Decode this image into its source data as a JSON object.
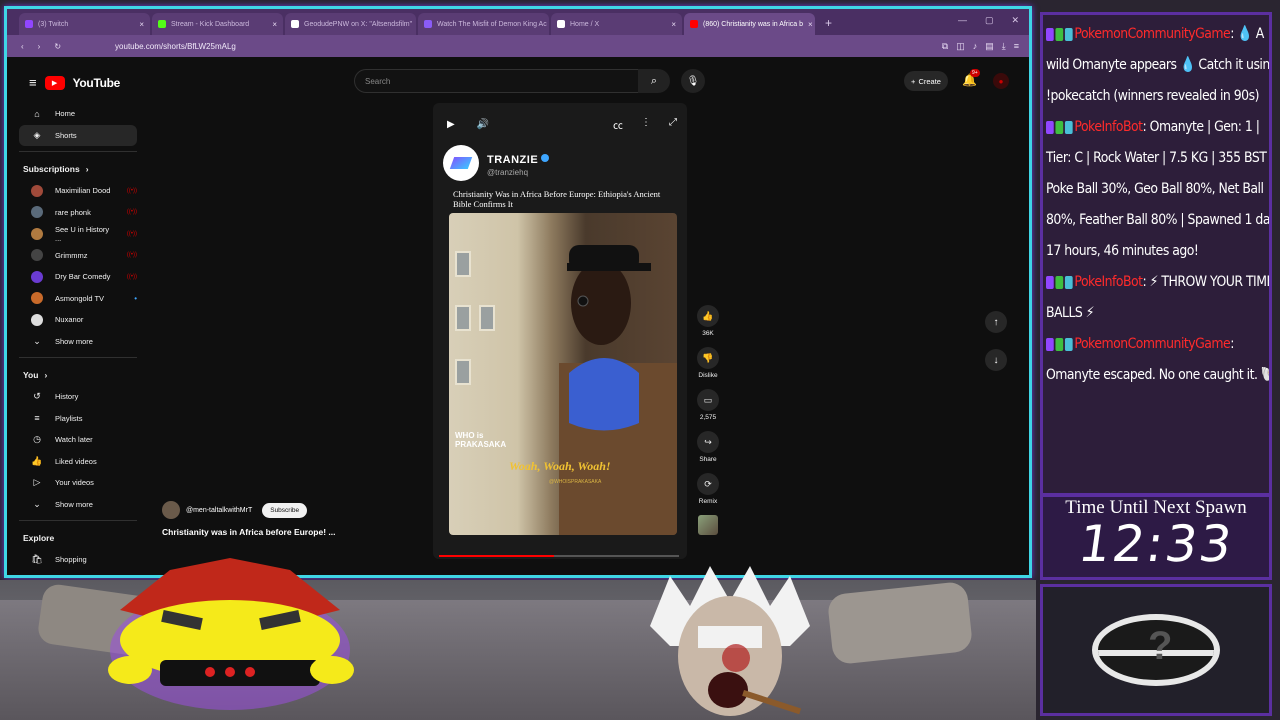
{
  "browser": {
    "tabs": [
      {
        "label": "(3) Twitch",
        "fav": "#9146ff"
      },
      {
        "label": "Stream - Kick Dashboard",
        "fav": "#53fc18"
      },
      {
        "label": "GeodudePNW on X: \"Altsendsfilm\"",
        "fav": "#ffffff"
      },
      {
        "label": "Watch The Misfit of Demon King Ac",
        "fav": "#8a5cf6"
      },
      {
        "label": "Home / X",
        "fav": "#ffffff"
      },
      {
        "label": "(860) Christianity was in Africa b",
        "fav": "#ff0000"
      }
    ],
    "url": "youtube.com/shorts/BfLW25mALg"
  },
  "youtube": {
    "logo_text": "YouTube",
    "search_placeholder": "Search",
    "create_label": "Create",
    "notif_count": "9+",
    "sidebar": {
      "main": [
        {
          "label": "Home",
          "icon": "home-icon",
          "glyph": "⌂"
        },
        {
          "label": "Shorts",
          "icon": "shorts-icon",
          "glyph": "◈"
        }
      ],
      "subscriptions_title": "Subscriptions",
      "subscriptions": [
        {
          "label": "Maximilian Dood",
          "color": "#a04a3a",
          "live": true
        },
        {
          "label": "rare phonk",
          "color": "#5a6a7a",
          "live": true
        },
        {
          "label": "See U in History ...",
          "color": "#b07a40",
          "live": true
        },
        {
          "label": "Grimmmz",
          "color": "#444",
          "live": true
        },
        {
          "label": "Dry Bar Comedy",
          "color": "#6a3bd1",
          "live": true
        },
        {
          "label": "Asmongold TV",
          "color": "#c86a2a",
          "live": false,
          "dot": true
        },
        {
          "label": "Nuxanor",
          "color": "#ddd",
          "live": false
        }
      ],
      "show_more": "Show more",
      "you_title": "You",
      "you": [
        {
          "label": "History",
          "glyph": "↺"
        },
        {
          "label": "Playlists",
          "glyph": "≡"
        },
        {
          "label": "Watch later",
          "glyph": "◷"
        },
        {
          "label": "Liked videos",
          "glyph": "👍"
        },
        {
          "label": "Your videos",
          "glyph": "▷"
        }
      ],
      "show_more_2": "Show more",
      "explore_title": "Explore",
      "explore": [
        {
          "label": "Shopping",
          "glyph": "🛍"
        }
      ]
    },
    "short": {
      "channel": "TRANZIE",
      "handle": "@tranziehq",
      "title": "Christianity Was in Africa Before Europe: Ethiopia's Ancient Bible Confirms It",
      "overlay_caption_1": "WHO is",
      "overlay_caption_2": "PRAKASAKA",
      "quote": "Woah, Woah, Woah!",
      "quote_sub": "@WHOISPRAKASAKA",
      "progress": 0.48
    },
    "actions": {
      "likes": "36K",
      "dislike": "Dislike",
      "comments": "2,575",
      "share": "Share",
      "remix": "Remix"
    },
    "uploader": {
      "handle": "@men-taltalkwithMrT",
      "subscribe": "Subscribe",
      "title": "Christianity was in Africa before Europe! ..."
    }
  },
  "chat": {
    "messages": [
      {
        "user": "PokemonCommunityGame",
        "text": ": 💧 A wild Omanyte appears 💧 Catch it using !pokecatch (winners revealed in 90s)"
      },
      {
        "user": "PokeInfoBot",
        "text": ": Omanyte | Gen: 1 | Tier: C | Rock Water | 7.5 KG | 355 BST | Poke Ball 30%, Geo Ball 80%, Net Ball 80%, Feather Ball 80% | Spawned 1 day, 17 hours, 46 minutes ago!"
      },
      {
        "user": "PokeInfoBot",
        "text": ": ⚡ THROW YOUR TIMER BALLS ⚡"
      },
      {
        "user": "PokemonCommunityGame",
        "text": ": Omanyte escaped. No one caught it. 🐚"
      }
    ]
  },
  "timer": {
    "label": "Time Until Next Spawn",
    "value": "12:33"
  },
  "colors": {
    "frame": "#3fd6e6",
    "panel_border": "#5b2fa0",
    "youtube_red": "#ff0000"
  }
}
